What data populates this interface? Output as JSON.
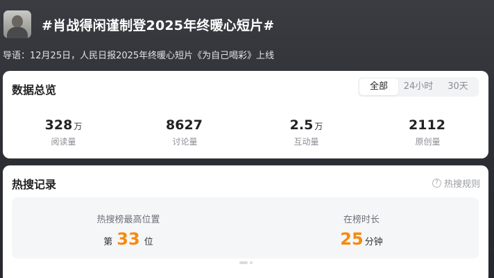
{
  "header": {
    "title": "#肖战得闲谨制登2025年终暖心短片#",
    "guide": "导语：12月25日，人民日报2025年终暖心短片《为自己喝彩》上线"
  },
  "overview": {
    "title": "数据总览",
    "tabs": [
      {
        "label": "全部",
        "active": true
      },
      {
        "label": "24小时",
        "active": false
      },
      {
        "label": "30天",
        "active": false
      }
    ],
    "stats": [
      {
        "value": "328",
        "unit": "万",
        "label": "阅读量"
      },
      {
        "value": "8627",
        "unit": "",
        "label": "讨论量"
      },
      {
        "value": "2.5",
        "unit": "万",
        "label": "互动量"
      },
      {
        "value": "2112",
        "unit": "",
        "label": "原创量"
      }
    ]
  },
  "hot": {
    "title": "热搜记录",
    "rules_label": "热搜规则",
    "rules_icon": "question-circle-icon",
    "peak": {
      "label": "热搜榜最高位置",
      "prefix": "第",
      "value": "33",
      "suffix": "位"
    },
    "duration": {
      "label": "在榜时长",
      "value": "25",
      "suffix": "分钟"
    }
  },
  "colors": {
    "accent": "#f68a0e",
    "background": "#2e3036"
  }
}
